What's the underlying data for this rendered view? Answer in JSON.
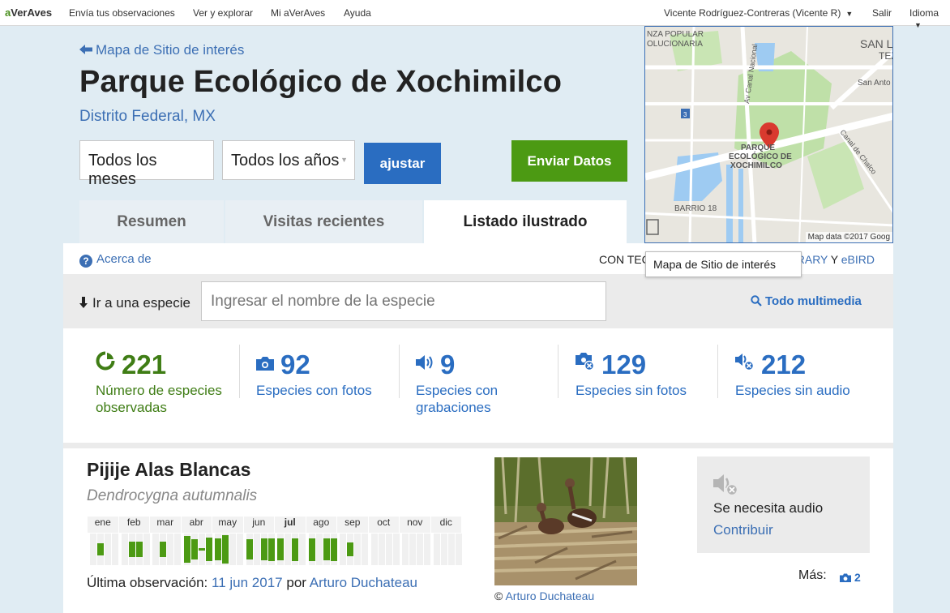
{
  "topbar": {
    "logo_a": "a",
    "logo_rest": "VerAves",
    "nav": [
      "Envía tus observaciones",
      "Ver y explorar",
      "Mi aVerAves",
      "Ayuda"
    ],
    "user": "Vicente Rodríguez-Contreras (Vicente R)",
    "logout": "Salir",
    "language": "Idioma"
  },
  "header": {
    "back_link": "Mapa de Sitio de interés",
    "title": "Parque Ecológico de Xochimilco",
    "region_state": "Distrito Federal",
    "region_comma": ",",
    "region_country": "MX"
  },
  "filters": {
    "months": "Todos los meses",
    "years": "Todos los años",
    "adjust": "ajustar",
    "submit": "Enviar Datos"
  },
  "map": {
    "labels": [
      "NZA POPULAR",
      "OLUCIONARIA",
      "SAN L",
      "TEZ",
      "Av Canal Nacional",
      "San Anto",
      "3",
      "PARQUE",
      "ECOLÓGICO DE",
      "XOCHIMILCO",
      "Canal de Chalco",
      "BARRIO 18"
    ],
    "credit": "Map data ©2017 Goog",
    "tooltip": "Mapa de Sitio de interés",
    "pin_color": "#d93a2f"
  },
  "tabs": [
    {
      "label": "Resumen"
    },
    {
      "label": "Visitas recientes"
    },
    {
      "label": "Listado ilustrado"
    }
  ],
  "info": {
    "about": "Acerca de",
    "credits_prefix": "CON TEC",
    "credits_library": "RARY",
    "credits_y": "Y",
    "credits_ebird": "eBIRD"
  },
  "search": {
    "goto_label": "Ir a una especie",
    "placeholder": "Ingresar el nombre de la especie",
    "multimedia": "Todo multimedia"
  },
  "stats": [
    {
      "value": "221",
      "label": "Número de especies observadas",
      "icon": "pie-chart-icon"
    },
    {
      "value": "92",
      "label": "Especies con fotos",
      "icon": "camera-icon"
    },
    {
      "value": "9",
      "label": "Especies con grabaciones",
      "icon": "speaker-icon"
    },
    {
      "value": "129",
      "label": "Especies sin fotos",
      "icon": "camera-off-icon"
    },
    {
      "value": "212",
      "label": "Especies sin audio",
      "icon": "speaker-off-icon"
    }
  ],
  "species": {
    "common_name": "Pijije Alas Blancas",
    "scientific_name": "Dendrocygna autumnalis",
    "months": [
      "ene",
      "feb",
      "mar",
      "abr",
      "may",
      "jun",
      "jul",
      "ago",
      "sep",
      "oct",
      "nov",
      "dic"
    ],
    "current_month": "jul",
    "frequency": [
      [
        0,
        0.45,
        0,
        0
      ],
      [
        0,
        0.55,
        0.55,
        0
      ],
      [
        0,
        0.55,
        0,
        0
      ],
      [
        0.95,
        0.7,
        0.1,
        0.85
      ],
      [
        0.75,
        1.0,
        0,
        0
      ],
      [
        0.7,
        0,
        0.75,
        0.8
      ],
      [
        0.75,
        0,
        0.8,
        0
      ],
      [
        0.8,
        0,
        0.75,
        0.8
      ],
      [
        0,
        0.5,
        0,
        0
      ],
      [
        0,
        0,
        0,
        0
      ],
      [
        0,
        0,
        0,
        0
      ],
      [
        0,
        0,
        0,
        0
      ]
    ],
    "last_obs_label": "Última observación:",
    "last_obs_date": "11 jun 2017",
    "last_obs_by": "por",
    "last_obs_observer": "Arturo Duchateau",
    "photo_credit_symbol": "©",
    "photo_credit_name": "Arturo Duchateau",
    "audio_needed": "Se necesita audio",
    "contribute": "Contribuir",
    "more_label": "Más:",
    "more_count": "2",
    "bar_color": "#4c9a13"
  }
}
